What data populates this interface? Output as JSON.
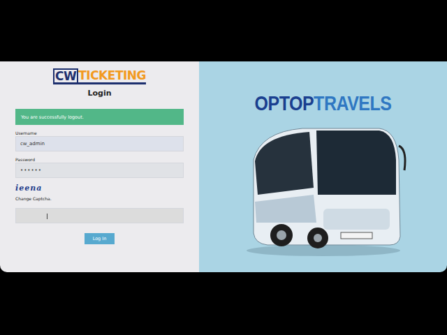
{
  "logo": {
    "prefix": "CW",
    "suffix": "TICKETING"
  },
  "title": "Login",
  "alert": "You are successfully logout.",
  "fields": [
    {
      "label": "Username",
      "value": "cw_admin",
      "kind": "text"
    },
    {
      "label": "Password",
      "value": "••••••",
      "kind": "password"
    }
  ],
  "captcha": {
    "text": "ieena",
    "link": "Change Captcha.",
    "value": ""
  },
  "button": "Log In",
  "brand": {
    "first": "OPTOP",
    "second": "TRAVELS"
  }
}
